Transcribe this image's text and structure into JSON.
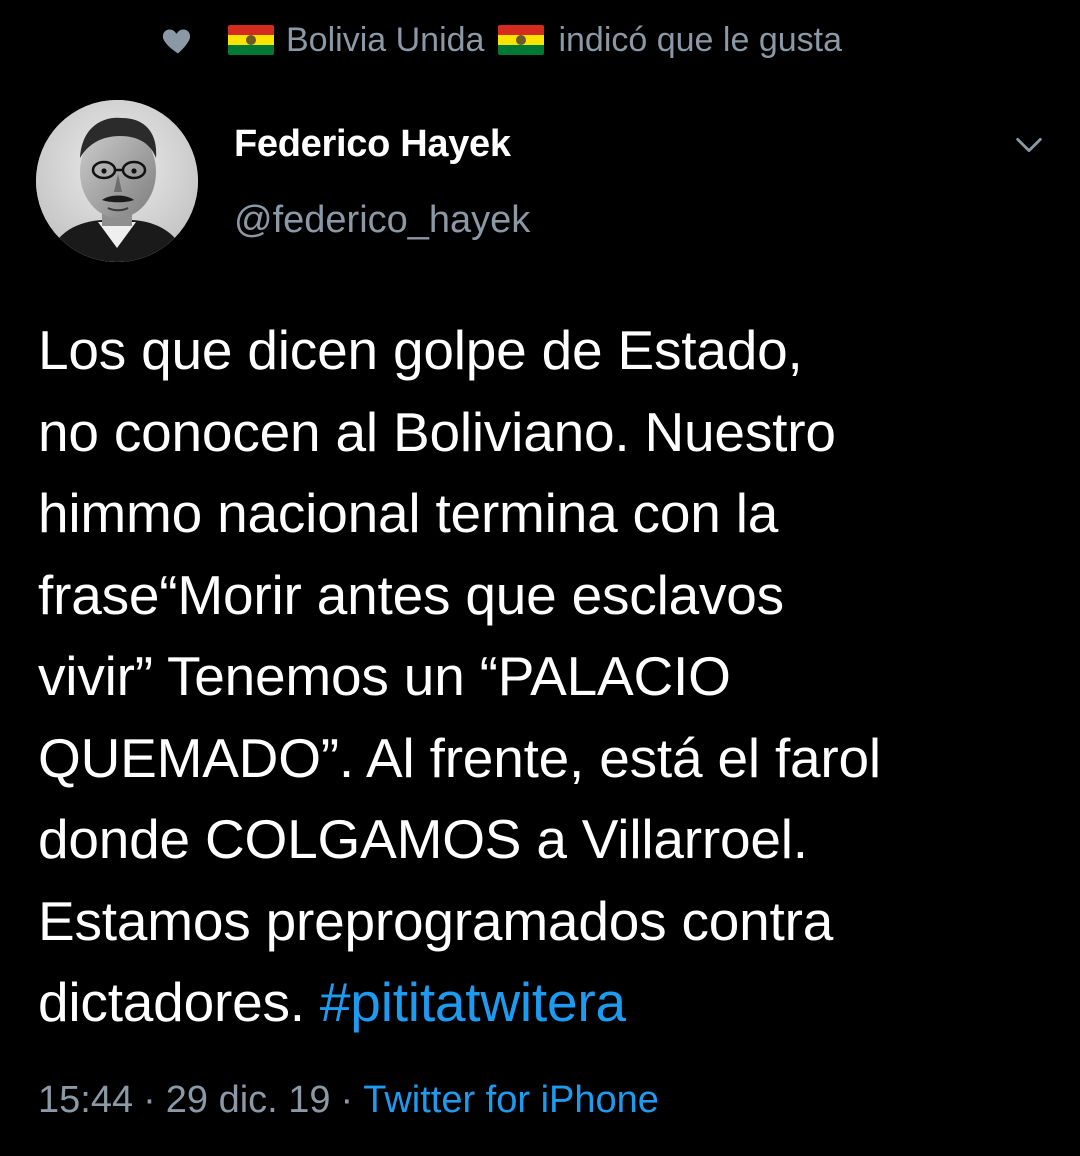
{
  "social_context": {
    "icon": "heart-icon",
    "name": "Bolivia Unida",
    "flag": "bolivia-flag-icon",
    "action": "indicó que le gusta"
  },
  "tweet": {
    "avatar": "avatar-photo",
    "display_name": "Federico Hayek",
    "handle": "@federico_hayek",
    "menu_icon": "chevron-down-icon",
    "text_lines": [
      "Los que dicen golpe de Estado,",
      "no conocen al Boliviano. Nuestro",
      "himmo nacional termina con la",
      "frase“Morir antes que esclavos",
      "vivir” Tenemos un “PALACIO",
      "QUEMADO”. Al frente, está el farol",
      "donde COLGAMOS a Villarroel.",
      "Estamos preprogramados contra"
    ],
    "last_line_text": "dictadores. ",
    "hashtag": "#pititatwitera",
    "time": "15:44",
    "separator": "·",
    "date": "29 dic. 19",
    "source": "Twitter for iPhone"
  },
  "colors": {
    "background": "#000000",
    "text": "#ffffff",
    "secondary": "#8b98a5",
    "link": "#1d9bf0"
  }
}
